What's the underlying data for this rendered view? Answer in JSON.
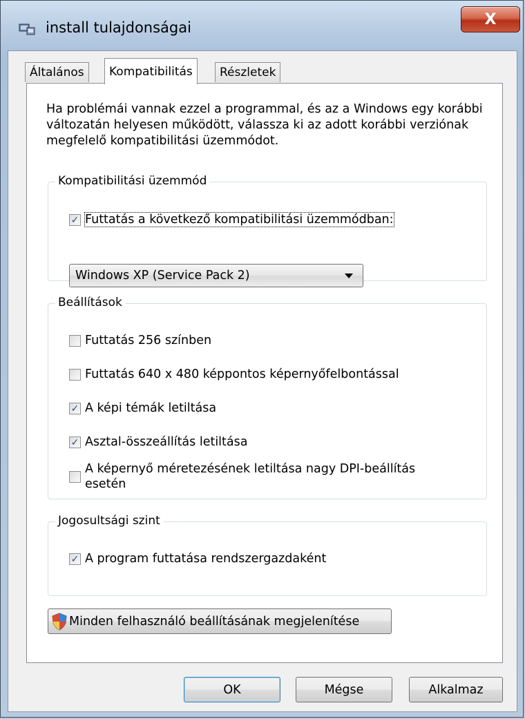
{
  "window": {
    "title": "install tulajdonságai",
    "close_label": "X"
  },
  "tabs": [
    {
      "label": "Általános"
    },
    {
      "label": "Kompatibilitás"
    },
    {
      "label": "Részletek"
    }
  ],
  "intro_text": "Ha problémái vannak ezzel a programmal, és az a Windows egy korábbi változatán helyesen működött, válassza ki az adott korábbi verziónak megfelelő kompatibilitási üzemmódot.",
  "compat_group": {
    "label": "Kompatibilitási üzemmód",
    "checkbox": {
      "label": "Futtatás a következő kompatibilitási üzemmódban:",
      "checked": true
    },
    "select_value": "Windows XP (Service Pack 2)"
  },
  "settings_group": {
    "label": "Beállítások",
    "items": [
      {
        "label": "Futtatás 256 színben",
        "checked": false
      },
      {
        "label": "Futtatás 640 x 480 képpontos képernyőfelbontással",
        "checked": false
      },
      {
        "label": "A képi témák letiltása",
        "checked": true
      },
      {
        "label": "Asztal-összeállítás letiltása",
        "checked": true
      },
      {
        "label": "A képernyő méretezésének letiltása nagy DPI-beállítás esetén",
        "checked": false
      }
    ]
  },
  "privilege_group": {
    "label": "Jogosultsági szint",
    "checkbox": {
      "label": "A program futtatása rendszergazdaként",
      "checked": true
    }
  },
  "all_users_button": "Minden felhasználó beállításának megjelenítése",
  "buttons": {
    "ok": "OK",
    "cancel": "Mégse",
    "apply": "Alkalmaz"
  },
  "check_glyph": "✓",
  "icons": {
    "app": "installer-icon",
    "shield": "uac-shield-icon"
  }
}
